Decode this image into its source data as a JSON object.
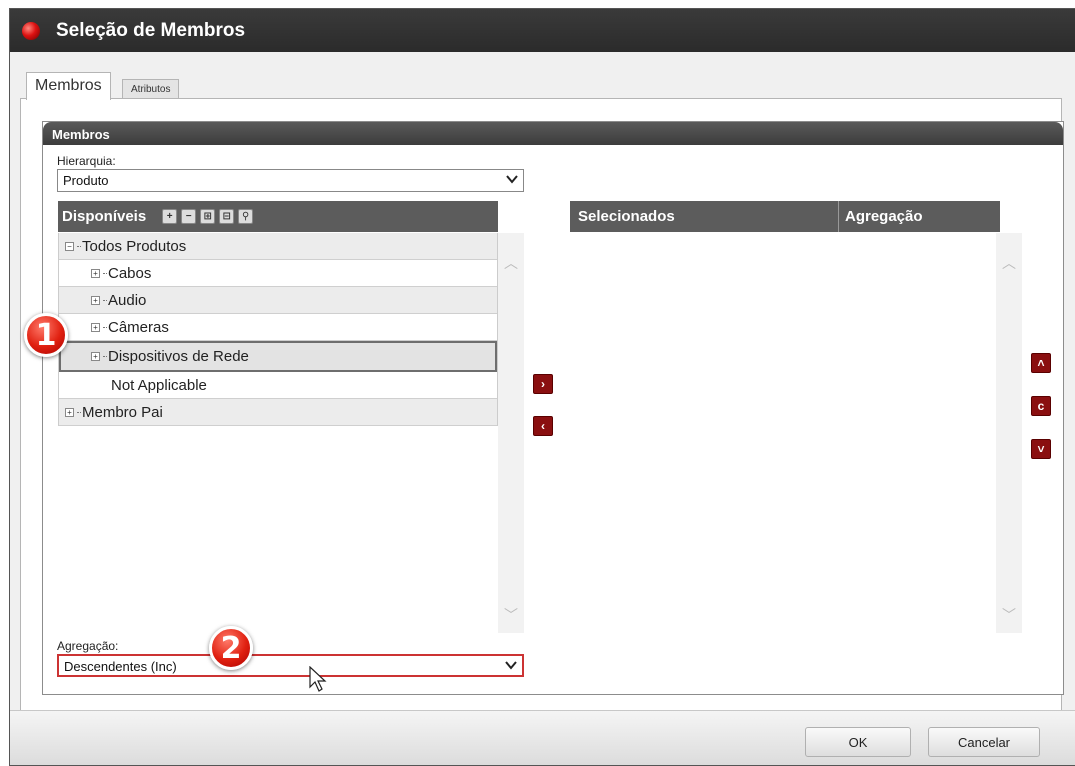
{
  "window": {
    "title": "Seleção de Membros"
  },
  "tabs": [
    {
      "label": "Membros",
      "active": true
    },
    {
      "label": "Atributos",
      "active": false
    }
  ],
  "panel": {
    "title": "Membros"
  },
  "hierarchy": {
    "label": "Hierarquia:",
    "value": "Produto"
  },
  "available": {
    "header": "Disponíveis",
    "toolbar_icons": [
      "expand-icon",
      "collapse-icon",
      "expand-level-icon",
      "collapse-level-icon",
      "search-icon"
    ],
    "tree": [
      {
        "label": "Todos Produtos",
        "expander": "−",
        "level": 0
      },
      {
        "label": "Cabos",
        "expander": "+",
        "level": 1
      },
      {
        "label": "Audio",
        "expander": "+",
        "level": 1
      },
      {
        "label": "Câmeras",
        "expander": "+",
        "level": 1
      },
      {
        "label": "Dispositivos de Rede",
        "expander": "+",
        "level": 1,
        "selected": true
      },
      {
        "label": "Not Applicable",
        "expander": "",
        "level": 1
      },
      {
        "label": "Membro Pai",
        "expander": "+",
        "level": 0
      }
    ]
  },
  "selected": {
    "header_selected": "Selecionados",
    "header_aggregation": "Agregação"
  },
  "aggregation": {
    "label": "Agregação:",
    "value": "Descendentes (Inc)"
  },
  "callouts": {
    "one": "1",
    "two": "2"
  },
  "move_buttons": {
    "add": "›",
    "remove": "‹",
    "up": "˄",
    "reset": "c",
    "down": "˅"
  },
  "footer": {
    "ok": "OK",
    "cancel": "Cancelar"
  },
  "colors": {
    "accent": "#8a0f10",
    "header": "#5c5c5c",
    "callout": "#e02010"
  }
}
